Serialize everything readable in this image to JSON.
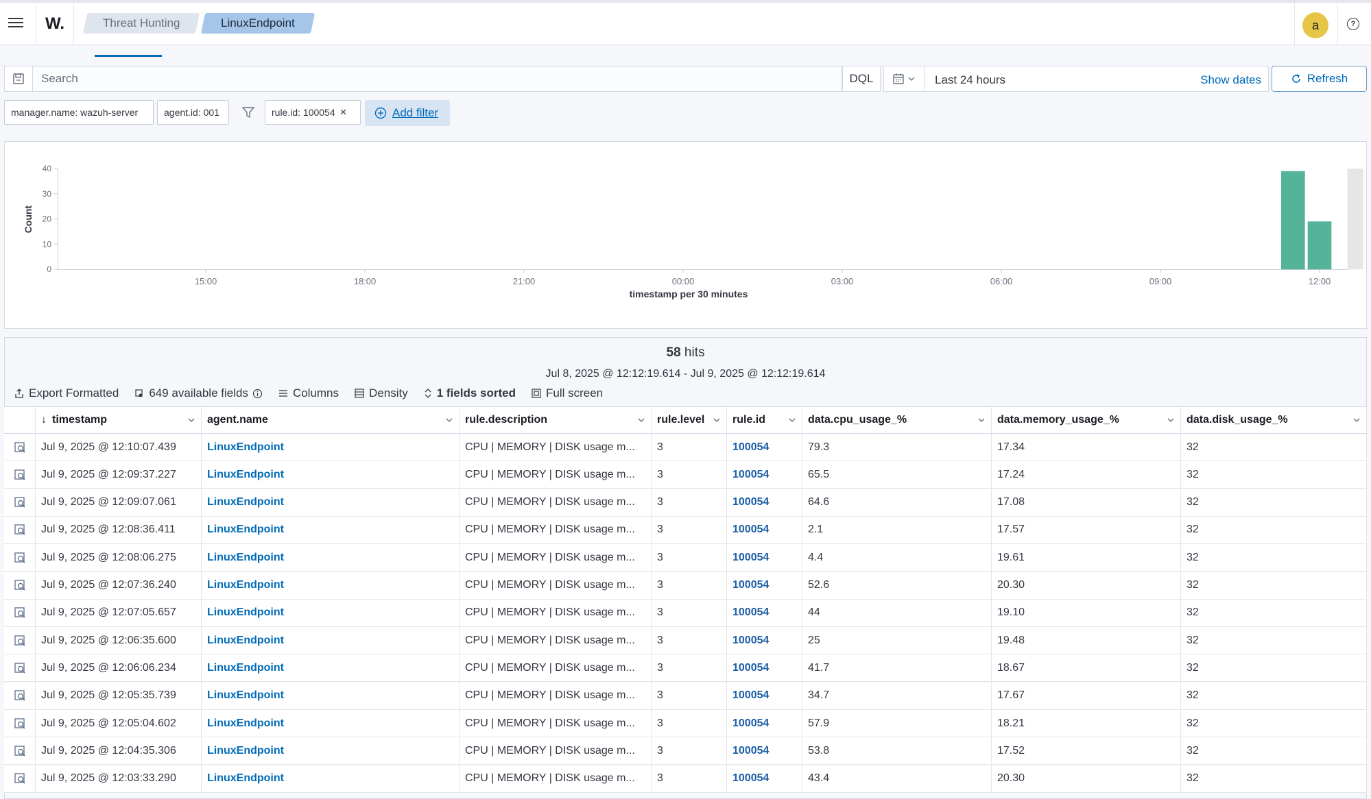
{
  "header": {
    "brand": "W.",
    "breadcrumbs": [
      "Threat Hunting",
      "LinuxEndpoint"
    ],
    "avatar_initial": "a",
    "help_symbol": "?"
  },
  "search": {
    "placeholder": "Search",
    "language": "DQL",
    "time_range": "Last 24 hours",
    "show_dates": "Show dates",
    "refresh": "Refresh"
  },
  "filters": {
    "pills": [
      "manager.name: wazuh-server",
      "agent.id: 001",
      "rule.id: 100054"
    ],
    "remove_symbol": "×",
    "add_filter": "Add filter"
  },
  "chart_data": {
    "type": "bar",
    "ylabel": "Count",
    "xlabel": "timestamp per 30 minutes",
    "ylim": [
      0,
      40
    ],
    "y_ticks": [
      "0",
      "10",
      "20",
      "30",
      "40"
    ],
    "x_ticks": [
      "15:00",
      "18:00",
      "21:00",
      "00:00",
      "03:00",
      "06:00",
      "09:00",
      "12:00"
    ],
    "bars": [
      {
        "label": "11:30",
        "value": 39
      },
      {
        "label": "12:00",
        "value": 19
      }
    ],
    "partial_bucket": {
      "label": "12:00",
      "value": 40
    },
    "colors": {
      "bar": "#54b399",
      "partial": "#e6e6e6"
    }
  },
  "results": {
    "hits_count": "58",
    "hits_label": "hits",
    "range": "Jul 8, 2025 @ 12:12:19.614 - Jul 9, 2025 @ 12:12:19.614",
    "toolbar": {
      "export": "Export Formatted",
      "fields": "649 available fields",
      "columns": "Columns",
      "density": "Density",
      "sorted": "1 fields sorted",
      "fullscreen": "Full screen"
    },
    "columns": [
      "timestamp",
      "agent.name",
      "rule.description",
      "rule.level",
      "rule.id",
      "data.cpu_usage_%",
      "data.memory_usage_%",
      "data.disk_usage_%"
    ],
    "rows": [
      [
        "Jul 9, 2025 @ 12:10:07.439",
        "LinuxEndpoint",
        "CPU | MEMORY | DISK usage m...",
        "3",
        "100054",
        "79.3",
        "17.34",
        "32"
      ],
      [
        "Jul 9, 2025 @ 12:09:37.227",
        "LinuxEndpoint",
        "CPU | MEMORY | DISK usage m...",
        "3",
        "100054",
        "65.5",
        "17.24",
        "32"
      ],
      [
        "Jul 9, 2025 @ 12:09:07.061",
        "LinuxEndpoint",
        "CPU | MEMORY | DISK usage m...",
        "3",
        "100054",
        "64.6",
        "17.08",
        "32"
      ],
      [
        "Jul 9, 2025 @ 12:08:36.411",
        "LinuxEndpoint",
        "CPU | MEMORY | DISK usage m...",
        "3",
        "100054",
        "2.1",
        "17.57",
        "32"
      ],
      [
        "Jul 9, 2025 @ 12:08:06.275",
        "LinuxEndpoint",
        "CPU | MEMORY | DISK usage m...",
        "3",
        "100054",
        "4.4",
        "19.61",
        "32"
      ],
      [
        "Jul 9, 2025 @ 12:07:36.240",
        "LinuxEndpoint",
        "CPU | MEMORY | DISK usage m...",
        "3",
        "100054",
        "52.6",
        "20.30",
        "32"
      ],
      [
        "Jul 9, 2025 @ 12:07:05.657",
        "LinuxEndpoint",
        "CPU | MEMORY | DISK usage m...",
        "3",
        "100054",
        "44",
        "19.10",
        "32"
      ],
      [
        "Jul 9, 2025 @ 12:06:35.600",
        "LinuxEndpoint",
        "CPU | MEMORY | DISK usage m...",
        "3",
        "100054",
        "25",
        "19.48",
        "32"
      ],
      [
        "Jul 9, 2025 @ 12:06:06.234",
        "LinuxEndpoint",
        "CPU | MEMORY | DISK usage m...",
        "3",
        "100054",
        "41.7",
        "18.67",
        "32"
      ],
      [
        "Jul 9, 2025 @ 12:05:35.739",
        "LinuxEndpoint",
        "CPU | MEMORY | DISK usage m...",
        "3",
        "100054",
        "34.7",
        "17.67",
        "32"
      ],
      [
        "Jul 9, 2025 @ 12:05:04.602",
        "LinuxEndpoint",
        "CPU | MEMORY | DISK usage m...",
        "3",
        "100054",
        "57.9",
        "18.21",
        "32"
      ],
      [
        "Jul 9, 2025 @ 12:04:35.306",
        "LinuxEndpoint",
        "CPU | MEMORY | DISK usage m...",
        "3",
        "100054",
        "53.8",
        "17.52",
        "32"
      ],
      [
        "Jul 9, 2025 @ 12:03:33.290",
        "LinuxEndpoint",
        "CPU | MEMORY | DISK usage m...",
        "3",
        "100054",
        "43.4",
        "20.30",
        "32"
      ]
    ]
  }
}
